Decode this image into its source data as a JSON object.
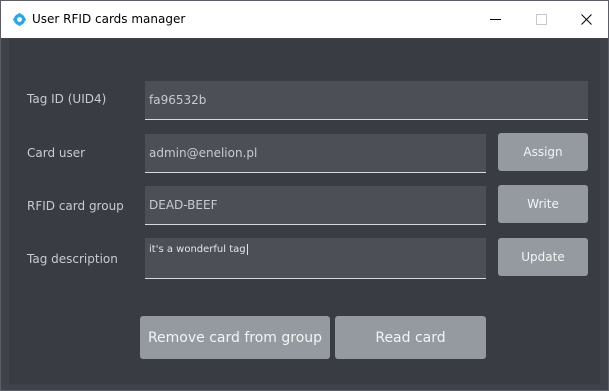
{
  "window": {
    "title": "User RFID cards manager",
    "icon": "gear-icon",
    "controls": {
      "minimize": "minimize-icon",
      "maximize": "maximize-icon",
      "close": "close-icon"
    }
  },
  "form": {
    "tag_id": {
      "label": "Tag ID (UID4)",
      "value": "fa96532b"
    },
    "card_user": {
      "label": "Card user",
      "value": "admin@enelion.pl",
      "button": "Assign"
    },
    "card_group": {
      "label": "RFID card group",
      "value": "DEAD-BEEF",
      "button": "Write"
    },
    "tag_description": {
      "label": "Tag description",
      "value": "it's a wonderful tag",
      "button": "Update"
    }
  },
  "actions": {
    "remove": "Remove card from group",
    "read": "Read card"
  },
  "colors": {
    "accent": "#2aa7e0",
    "button": "#959aa1",
    "background": "#393c42",
    "field": "#4c4f56"
  }
}
